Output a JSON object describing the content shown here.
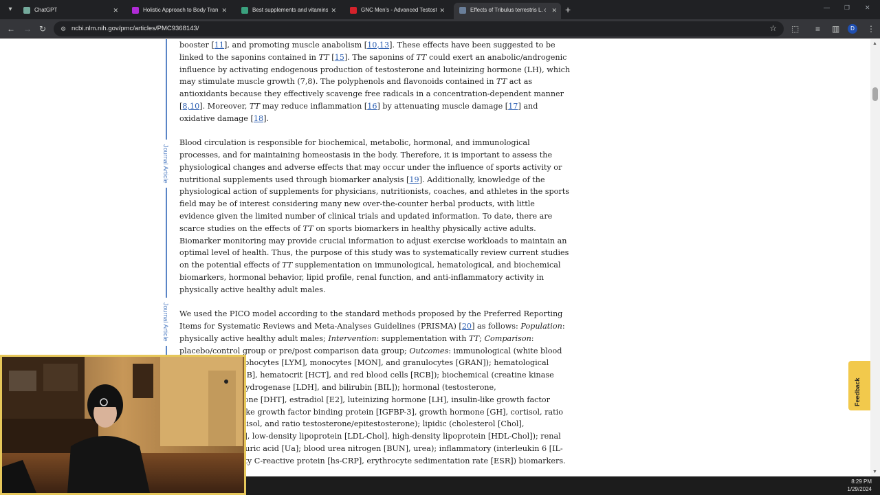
{
  "browser": {
    "tabs": [
      {
        "label": "ChatGPT",
        "favicon_color": "#74aa9c",
        "active": false
      },
      {
        "label": "Holistic Approach to Body Tran",
        "favicon_color": "#b02bd6",
        "active": false
      },
      {
        "label": "Best supplements and vitamins",
        "favicon_color": "#3aa17e",
        "active": false
      },
      {
        "label": "GNC Men's - Advanced Testoste",
        "favicon_color": "#d4222b",
        "active": false
      },
      {
        "label": "Effects of Tribulus terrestris L. o",
        "favicon_color": "#6a7f9a",
        "active": true
      }
    ],
    "url": "ncbi.nlm.nih.gov/pmc/articles/PMC9368143/",
    "profile_initial": "D"
  },
  "page": {
    "side_label": "Journal Article",
    "paragraphs": [
      {
        "parts": [
          {
            "t": "booster ["
          },
          {
            "t": "11",
            "ref": true
          },
          {
            "t": "], and promoting muscle anabolism ["
          },
          {
            "t": "10,13",
            "ref": true
          },
          {
            "t": "]. These effects have been suggested to be linked to the saponins contained in "
          },
          {
            "t": "TT",
            "i": true
          },
          {
            "t": " ["
          },
          {
            "t": "15",
            "ref": true
          },
          {
            "t": "]. The saponins of "
          },
          {
            "t": "TT",
            "i": true
          },
          {
            "t": " could exert an anabolic/androgenic influence by activating endogenous production of testosterone and luteinizing hormone (LH), which may stimulate muscle growth (7,8). The polyphenols and flavonoids contained in "
          },
          {
            "t": "TT",
            "i": true
          },
          {
            "t": " act as antioxidants because they effectively scavenge free radicals in a concentration-dependent manner ["
          },
          {
            "t": "8,10",
            "ref": true
          },
          {
            "t": "]. Moreover, "
          },
          {
            "t": "TT",
            "i": true
          },
          {
            "t": " may reduce inflammation ["
          },
          {
            "t": "16",
            "ref": true
          },
          {
            "t": "] by attenuating muscle damage ["
          },
          {
            "t": "17",
            "ref": true
          },
          {
            "t": "] and oxidative damage ["
          },
          {
            "t": "18",
            "ref": true
          },
          {
            "t": "]."
          }
        ]
      },
      {
        "parts": [
          {
            "t": "Blood circulation is responsible for biochemical, metabolic, hormonal, and immunological processes, and for maintaining homeostasis in the body. Therefore, it is important to assess the physiological changes and adverse effects that may occur under the influence of sports activity or nutritional supplements used through biomarker analysis ["
          },
          {
            "t": "19",
            "ref": true
          },
          {
            "t": "]. Additionally, knowledge of the physiological action of supplements for physicians, nutritionists, coaches, and athletes in the sports field may be of interest considering many new over-the-counter herbal products, with little evidence given the limited number of clinical trials and updated information. To date, there are scarce studies on the effects of "
          },
          {
            "t": "TT",
            "i": true
          },
          {
            "t": " on sports biomarkers in healthy physically active adults. Biomarker monitoring may provide crucial information to adjust exercise workloads to maintain an optimal level of health. Thus, the purpose of this study was to systematically review current studies on the potential effects of "
          },
          {
            "t": "TT",
            "i": true
          },
          {
            "t": " supplementation on immunological, hematological, and biochemical biomarkers, hormonal behavior, lipid profile, renal function, and anti-inflammatory activity in physically active healthy adult males."
          }
        ]
      },
      {
        "parts": [
          {
            "t": "We used the PICO model according to the standard methods proposed by the Preferred Reporting Items for Systematic Reviews and Meta-Analyses Guidelines (PRISMA) ["
          },
          {
            "t": "20",
            "ref": true
          },
          {
            "t": "] as follows: "
          },
          {
            "t": "Population",
            "i": true
          },
          {
            "t": ": physically active healthy adult males; "
          },
          {
            "t": "Intervention",
            "i": true
          },
          {
            "t": ": supplementation with "
          },
          {
            "t": "TT",
            "i": true
          },
          {
            "t": "; "
          },
          {
            "t": "Comparison",
            "i": true
          },
          {
            "t": ": placebo/control group or pre/post comparison data group; "
          },
          {
            "t": "Outcomes",
            "i": true
          },
          {
            "t": ": immunological (white blood cells [WBC], lymphocytes [LYM], monocytes [MON], and granulocytes [GRAN]); hematological (hemoglobin [HGB], hematocrit [HCT], and red blood cells [RCB]); biochemical (creatine kinase [CK], lactate dehydrogenase [LDH], and bilirubin [BIL]); hormonal (testosterone, dihydrotestosterone [DHT], estradiol [E2], luteinizing hormone [LH], insulin-like growth factor [IGF-1], insulin-like growth factor binding protein [IGFBP-3], growth hormone [GH], cortisol, ratio testosterone/cortisol, and ratio testosterone/epitestosterone); lipidic (cholesterol [Chol], triglycerides [Tg], low-density lipoprotein [LDL-Chol], high-density lipoprotein [HDL-Chol]); renal (creatinine [Cr], uric acid [Ua]; blood urea nitrogen [BUN], urea); inflammatory (interleukin 6 [IL-6], high-sensitivity C-reactive protein [hs-CRP], erythrocyte sedimentation rate [ESR]) biomarkers."
          }
        ]
      }
    ],
    "feedback_label": "Feedback"
  },
  "taskbar": {
    "time": "8:29 PM",
    "date": "1/29/2024"
  },
  "colors": {
    "link": "#2a5db0",
    "side_rule": "#5a85c6",
    "feedback_bg": "#f2c94c",
    "webcam_border": "#e6c75a"
  }
}
